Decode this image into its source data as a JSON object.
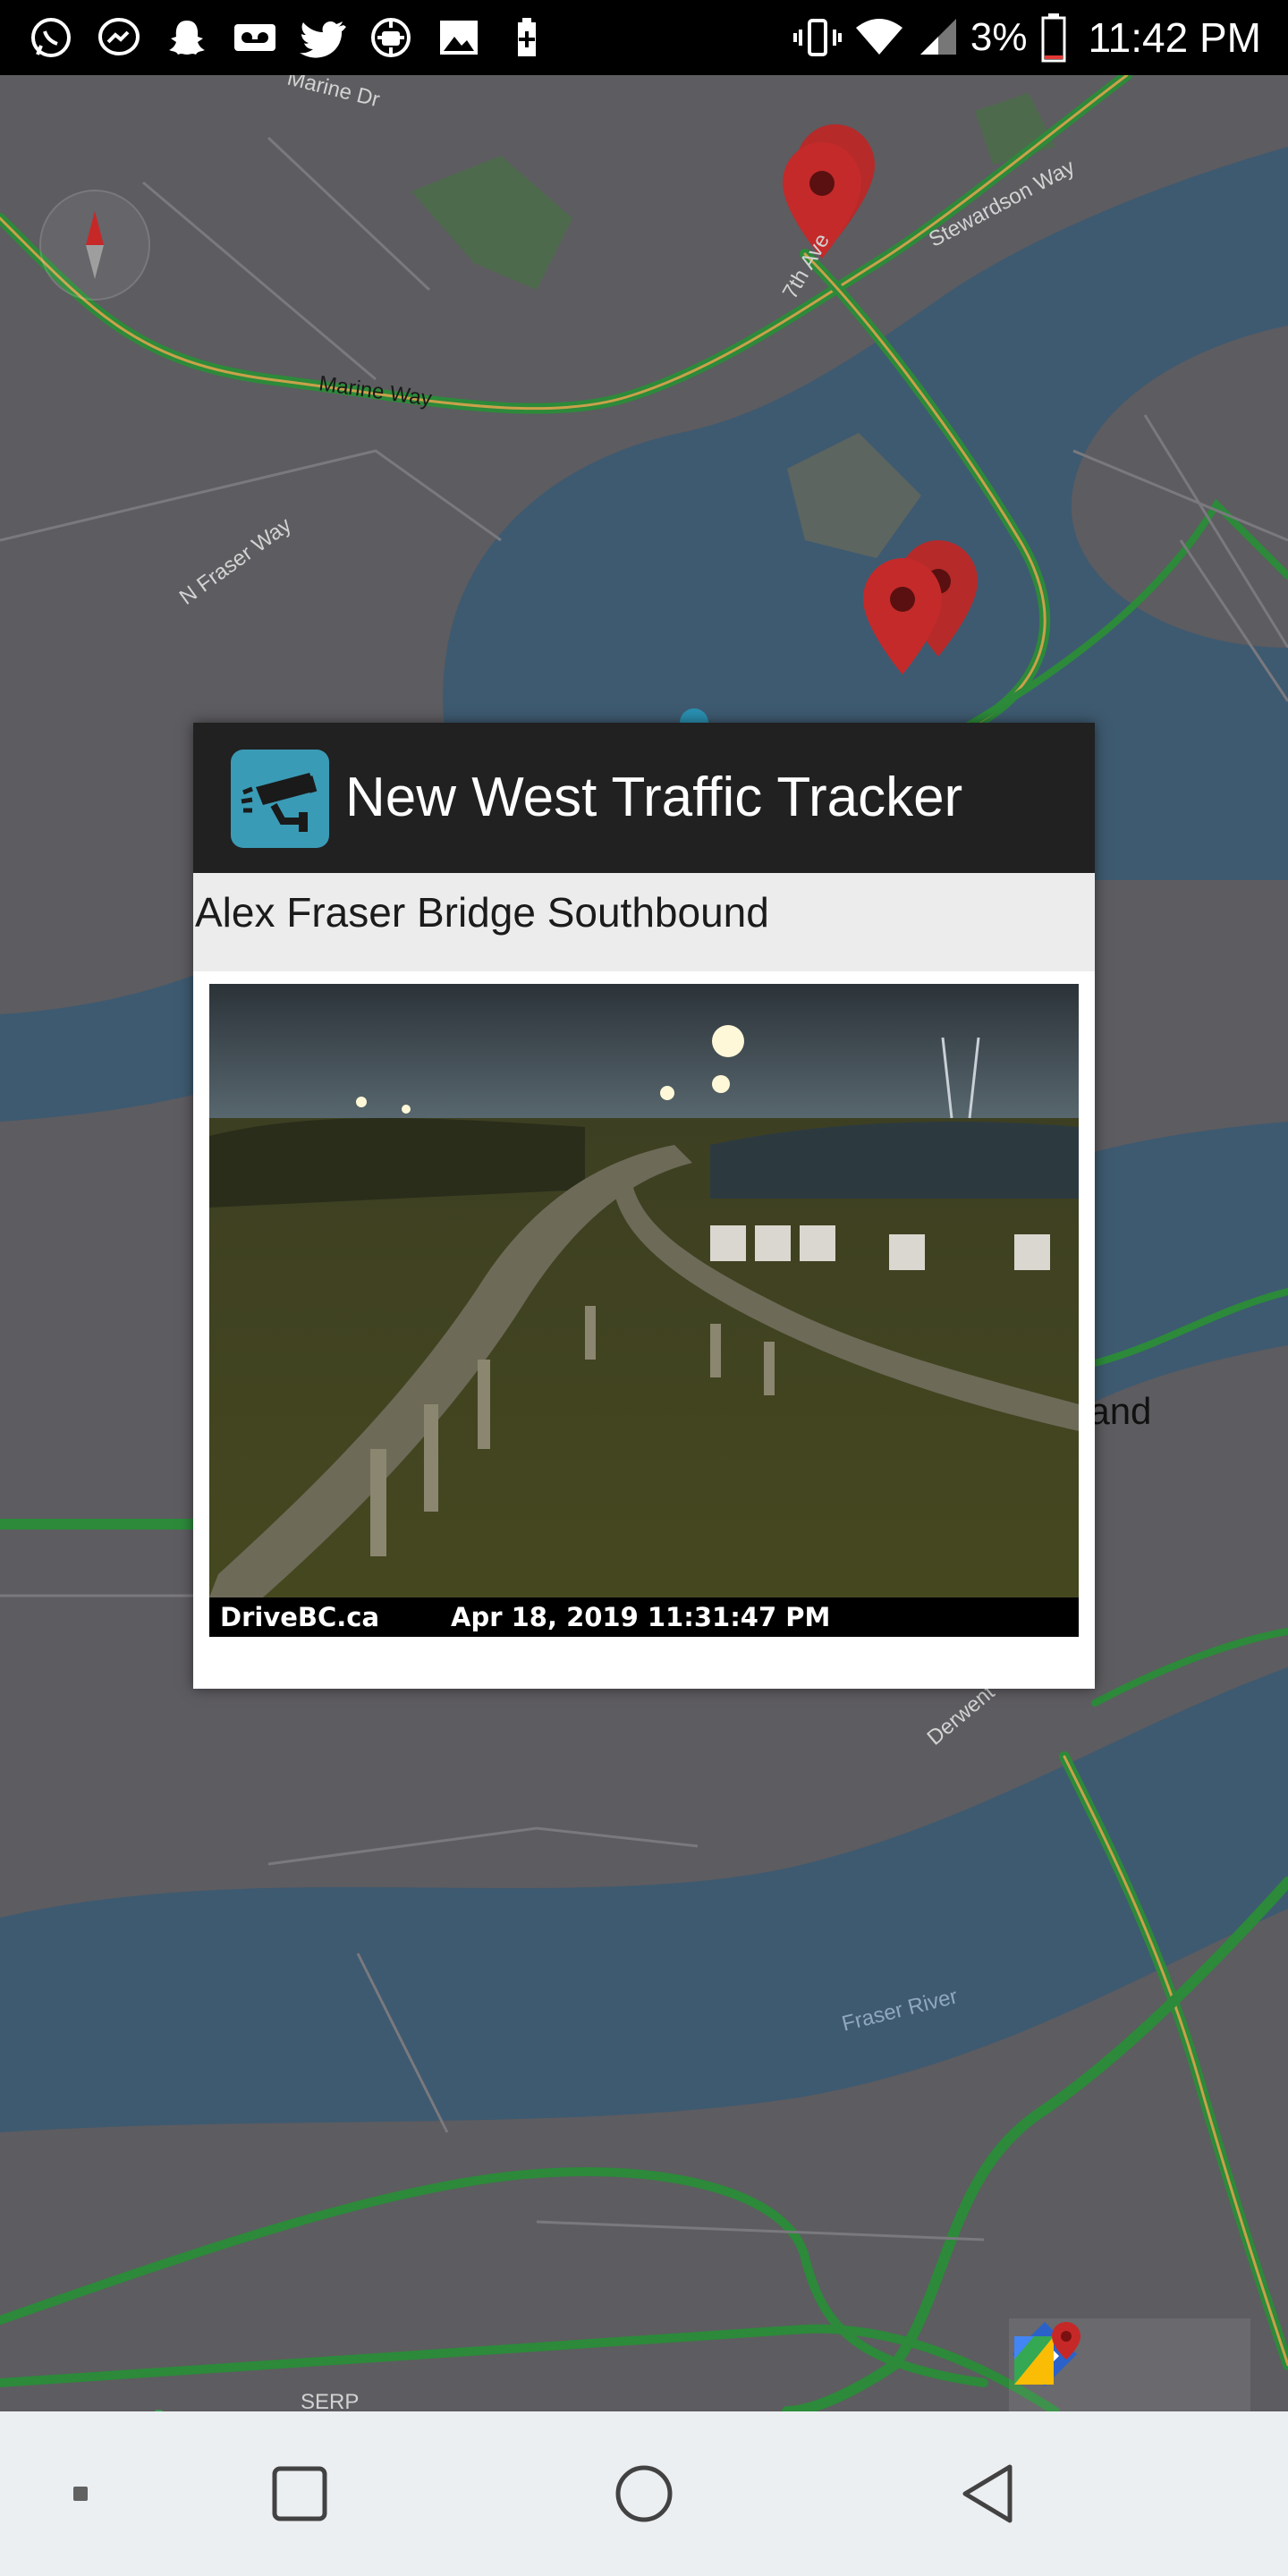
{
  "status_bar": {
    "left_icons": [
      "whatsapp-icon",
      "messenger-icon",
      "snapchat-icon",
      "voicemail-icon",
      "twitter-icon",
      "android-debug-icon",
      "image-icon",
      "battery-saver-icon"
    ],
    "battery_percent": "3%",
    "time": "11:42 PM"
  },
  "map": {
    "street_labels": [
      "Marine Dr",
      "Marine Way",
      "N Fraser Way",
      "7th Ave",
      "Stewardson Way",
      "Derwent",
      "Fraser River",
      "SERP"
    ],
    "island_label": "land",
    "attribution": "Google",
    "markers": [
      "map-marker",
      "map-marker",
      "map-marker",
      "map-marker"
    ],
    "colors": {
      "water": "#3e5a70",
      "land": "#5d5c60",
      "traffic_green": "#2c8a3a",
      "marker": "#c42a2a"
    }
  },
  "dialog": {
    "title": "New West Traffic Tracker",
    "camera_name": "Alex Fraser Bridge Southbound",
    "image_source": "DriveBC.ca",
    "image_timestamp": "Apr 18, 2019 11:31:47 PM"
  },
  "map_toolbar": {
    "directions_icon": "directions-icon",
    "open_in_maps_icon": "google-maps-icon"
  },
  "nav_bar": {
    "buttons": [
      "menu",
      "recent-apps",
      "home",
      "back"
    ]
  }
}
